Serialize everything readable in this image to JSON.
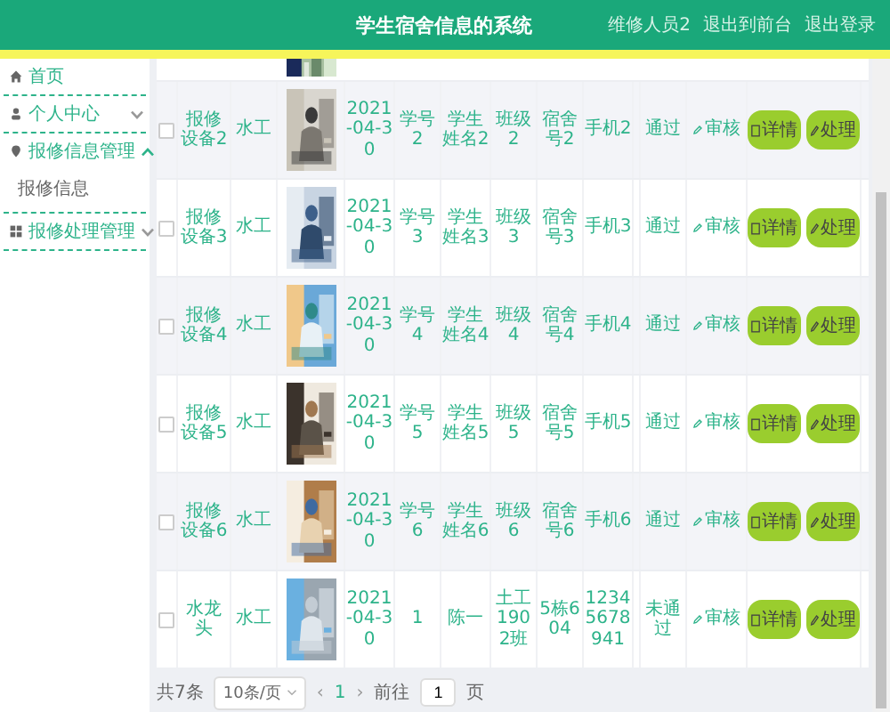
{
  "header": {
    "title": "学生宿舍信息的系统",
    "user": "维修人员2",
    "links": [
      "退出到前台",
      "退出登录"
    ]
  },
  "sidebar": {
    "items": [
      {
        "label": "首页"
      },
      {
        "label": "个人中心",
        "expanded": false
      },
      {
        "label": "报修信息管理",
        "expanded": true,
        "children": [
          {
            "label": "报修信息"
          }
        ]
      },
      {
        "label": "报修处理管理",
        "expanded": false
      }
    ]
  },
  "table": {
    "rows": [
      {
        "checked": false,
        "name": "报修设备2",
        "type": "水工",
        "date": "2021-04-30",
        "student_no": "学号2",
        "student_name": "学生姓名2",
        "class": "班级2",
        "dorm": "宿舍号2",
        "phone": "手机2",
        "status": "通过",
        "review": "审核",
        "actions": [
          "详情",
          "处理"
        ]
      },
      {
        "checked": false,
        "name": "报修设备3",
        "type": "水工",
        "date": "2021-04-30",
        "student_no": "学号3",
        "student_name": "学生姓名3",
        "class": "班级3",
        "dorm": "宿舍号3",
        "phone": "手机3",
        "status": "通过",
        "review": "审核",
        "actions": [
          "详情",
          "处理"
        ]
      },
      {
        "checked": false,
        "name": "报修设备4",
        "type": "水工",
        "date": "2021-04-30",
        "student_no": "学号4",
        "student_name": "学生姓名4",
        "class": "班级4",
        "dorm": "宿舍号4",
        "phone": "手机4",
        "status": "通过",
        "review": "审核",
        "actions": [
          "详情",
          "处理"
        ]
      },
      {
        "checked": false,
        "name": "报修设备5",
        "type": "水工",
        "date": "2021-04-30",
        "student_no": "学号5",
        "student_name": "学生姓名5",
        "class": "班级5",
        "dorm": "宿舍号5",
        "phone": "手机5",
        "status": "通过",
        "review": "审核",
        "actions": [
          "详情",
          "处理"
        ]
      },
      {
        "checked": false,
        "name": "报修设备6",
        "type": "水工",
        "date": "2021-04-30",
        "student_no": "学号6",
        "student_name": "学生姓名6",
        "class": "班级6",
        "dorm": "宿舍号6",
        "phone": "手机6",
        "status": "通过",
        "review": "审核",
        "actions": [
          "详情",
          "处理"
        ]
      },
      {
        "checked": false,
        "name": "水龙头",
        "type": "水工",
        "date": "2021-04-30",
        "student_no": "1",
        "student_name": "陈一",
        "class": "土工1902班",
        "dorm": "5栋604",
        "phone": "12345678941",
        "status": "未通过",
        "review": "审核",
        "actions": [
          "详情",
          "处理"
        ]
      }
    ]
  },
  "pagination": {
    "total": "共7条",
    "page_size": "10条/页",
    "prev": "‹",
    "page": "1",
    "next": "›",
    "goto_label": "前往",
    "goto_value": "1",
    "goto_suffix": "页"
  }
}
